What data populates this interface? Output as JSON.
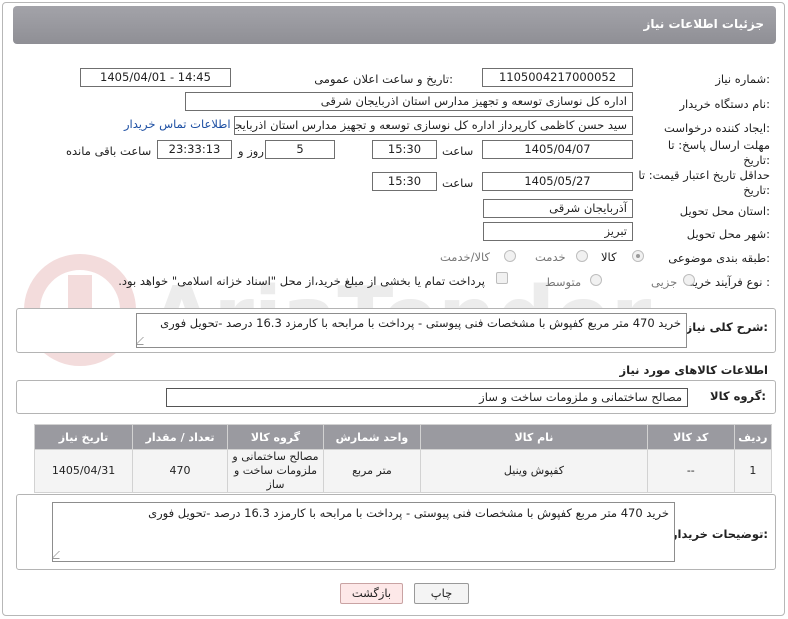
{
  "header": {
    "title": "جزئیات اطلاعات نیاز"
  },
  "fields": {
    "need_number_label": "شماره نیاز:",
    "need_number": "1105004217000052",
    "announce_label": "تاریخ و ساعت اعلان عمومی:",
    "announce_value": "1405/04/01 - 14:45",
    "buyer_org_label": "نام دستگاه خریدار:",
    "buyer_org": "اداره کل نوسازی  توسعه و تجهیز مدارس استان اذربایجان شرقی",
    "requester_label": "ایجاد کننده درخواست:",
    "requester": "سید حسن کاظمی کارپرداز اداره کل نوسازی  توسعه و تجهیز مدارس استان اذربایجان شرقی",
    "contact_link": "اطلاعات تماس خریدار",
    "reply_deadline_label": "مهلت ارسال پاسخ: تا تاریخ:",
    "reply_date": "1405/04/07",
    "time_label": "ساعت",
    "reply_time": "15:30",
    "days_value": "5",
    "days_label": "روز و",
    "remaining_time": "23:33:13",
    "remaining_label": "ساعت باقی مانده",
    "price_validity_label": "حداقل تاریخ اعتبار قیمت: تا تاریخ:",
    "price_date": "1405/05/27",
    "price_time": "15:30",
    "province_label": "استان محل تحویل:",
    "province": "آذربایجان شرقی",
    "city_label": "شهر محل تحویل:",
    "city": "تبریز",
    "category_label": "طبقه بندی موضوعی:",
    "category_options": [
      "کالا",
      "خدمت",
      "کالا/خدمت"
    ],
    "purchase_type_label": "نوع فرآیند خرید :",
    "purchase_options": [
      "جزیی",
      "متوسط"
    ],
    "payment_note": "پرداخت تمام یا بخشی از مبلغ خرید،از محل \"اسناد خزانه اسلامی\" خواهد بود."
  },
  "description": {
    "label": "شرح کلی نیاز:",
    "text": "خرید  470 متر مربع کفپوش با مشخصات فنی پیوستی - پرداخت با مرابحه با کارمزد 16.3 درصد -تحویل فوری"
  },
  "goods": {
    "section_title": "اطلاعات کالاهای مورد نیاز",
    "group_label": "گروه کالا:",
    "group_value": "مصالح ساختمانی و ملزومات ساخت و ساز",
    "columns": [
      "ردیف",
      "کد کالا",
      "نام کالا",
      "واحد شمارش",
      "گروه کالا",
      "تعداد / مقدار",
      "تاریخ نیاز"
    ],
    "rows": [
      {
        "row": "1",
        "code": "--",
        "name": "کفپوش وینیل",
        "unit": "متر مربع",
        "group": "مصالح ساختمانی و ملزومات ساخت و ساز",
        "qty": "470",
        "date": "1405/04/31"
      }
    ]
  },
  "buyer_notes": {
    "label": "توضیحات خریدار:",
    "text": "خرید  470 متر مربع کفپوش با مشخصات فنی پیوستی - پرداخت با مرابحه با کارمزد 16.3 درصد -تحویل فوری"
  },
  "buttons": {
    "print": "چاپ",
    "back": "بازگشت"
  },
  "watermark": {
    "text": "AriaTender.net",
    "color": "#f2dede"
  },
  "colors": {
    "header_bg": "#9a9aa0",
    "back_button_bg": "#fde8e8",
    "link": "#1d4fa3"
  }
}
